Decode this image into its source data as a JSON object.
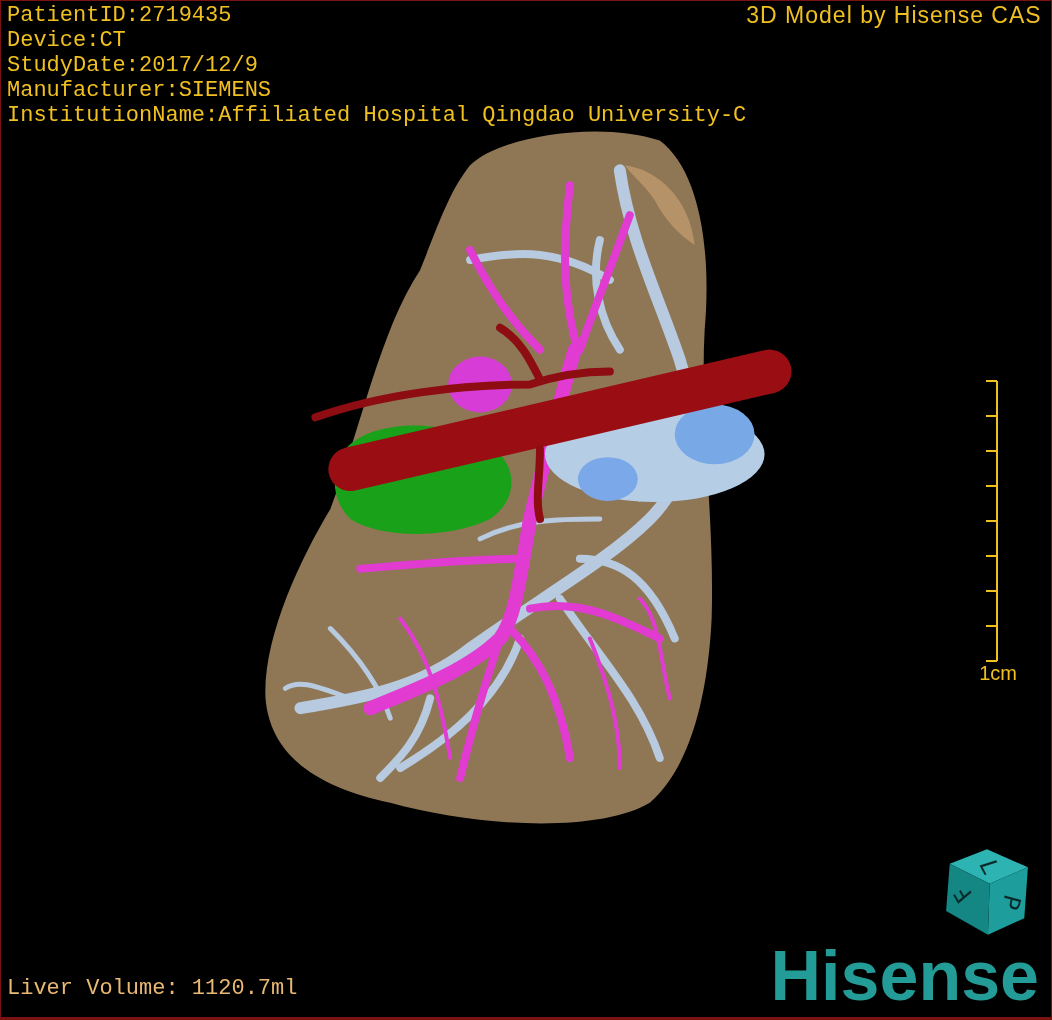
{
  "header": {
    "info_lines": [
      "PatientID:2719435",
      "Device:CT",
      "StudyDate:2017/12/9",
      "Manufacturer:SIEMENS",
      "InstitutionName:Affiliated Hospital Qingdao University-C"
    ],
    "title": "3D Model by Hisense CAS"
  },
  "scale_bar": {
    "label": "1cm"
  },
  "orientation_cube": {
    "faces": [
      "L",
      "P",
      "F"
    ]
  },
  "footer": {
    "liver_volume": "Liver Volume: 1120.7ml",
    "logo": "Hisense"
  }
}
